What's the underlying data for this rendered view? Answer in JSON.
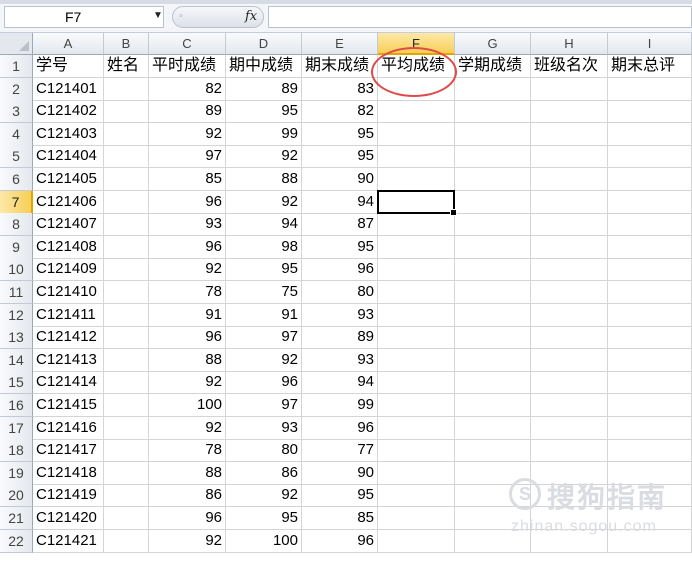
{
  "formula_bar": {
    "name_box": "F7",
    "name_box_dropdown_icon": "dropdown-arrow-icon",
    "fx_label": "fx",
    "formula_value": ""
  },
  "sheet": {
    "columns": [
      "A",
      "B",
      "C",
      "D",
      "E",
      "F",
      "G",
      "H",
      "I"
    ],
    "selected_column": "F",
    "selected_row": 7,
    "header_row": [
      "学号",
      "姓名",
      "平时成绩",
      "期中成绩",
      "期末成绩",
      "平均成绩",
      "学期成绩",
      "班级名次",
      "期末总评"
    ],
    "rows": [
      {
        "n": "2",
        "id": "C121401",
        "c": "82",
        "d": "89",
        "e": "83"
      },
      {
        "n": "3",
        "id": "C121402",
        "c": "89",
        "d": "95",
        "e": "82"
      },
      {
        "n": "4",
        "id": "C121403",
        "c": "92",
        "d": "99",
        "e": "95"
      },
      {
        "n": "5",
        "id": "C121404",
        "c": "97",
        "d": "92",
        "e": "95"
      },
      {
        "n": "6",
        "id": "C121405",
        "c": "85",
        "d": "88",
        "e": "90"
      },
      {
        "n": "7",
        "id": "C121406",
        "c": "96",
        "d": "92",
        "e": "94"
      },
      {
        "n": "8",
        "id": "C121407",
        "c": "93",
        "d": "94",
        "e": "87"
      },
      {
        "n": "9",
        "id": "C121408",
        "c": "96",
        "d": "98",
        "e": "95"
      },
      {
        "n": "10",
        "id": "C121409",
        "c": "92",
        "d": "95",
        "e": "96"
      },
      {
        "n": "11",
        "id": "C121410",
        "c": "78",
        "d": "75",
        "e": "80"
      },
      {
        "n": "12",
        "id": "C121411",
        "c": "91",
        "d": "91",
        "e": "93"
      },
      {
        "n": "13",
        "id": "C121412",
        "c": "96",
        "d": "97",
        "e": "89"
      },
      {
        "n": "14",
        "id": "C121413",
        "c": "88",
        "d": "92",
        "e": "93"
      },
      {
        "n": "15",
        "id": "C121414",
        "c": "92",
        "d": "96",
        "e": "94"
      },
      {
        "n": "16",
        "id": "C121415",
        "c": "100",
        "d": "97",
        "e": "99"
      },
      {
        "n": "17",
        "id": "C121416",
        "c": "92",
        "d": "93",
        "e": "96"
      },
      {
        "n": "18",
        "id": "C121417",
        "c": "78",
        "d": "80",
        "e": "77"
      },
      {
        "n": "19",
        "id": "C121418",
        "c": "88",
        "d": "86",
        "e": "90"
      },
      {
        "n": "20",
        "id": "C121419",
        "c": "86",
        "d": "92",
        "e": "95"
      },
      {
        "n": "21",
        "id": "C121420",
        "c": "96",
        "d": "95",
        "e": "85"
      },
      {
        "n": "22",
        "id": "C121421",
        "c": "92",
        "d": "100",
        "e": "96"
      }
    ]
  },
  "annotation": {
    "color": "#e04a4a",
    "target": "F1"
  },
  "watermark": {
    "logo_letter": "S",
    "brand": "搜狗指南",
    "url": "zhinan.sogou.com"
  }
}
